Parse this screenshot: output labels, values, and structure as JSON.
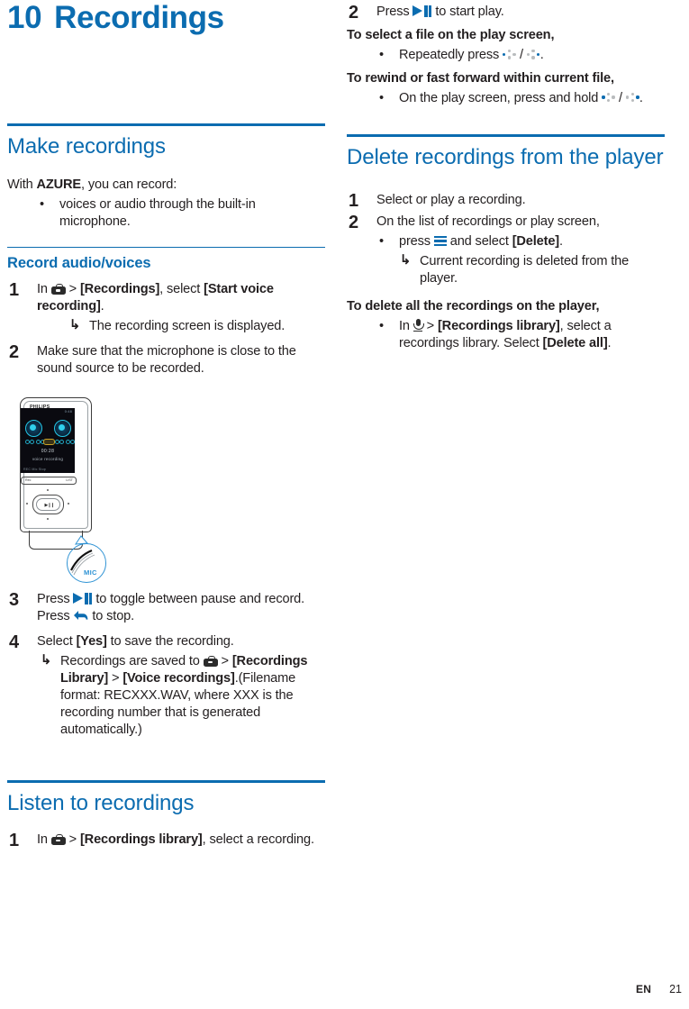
{
  "document": {
    "chapter_number": "10",
    "chapter_title": "Recordings",
    "footer_language": "EN",
    "footer_page": "21",
    "accent_color": "#0b6cb0",
    "text_color": "#231f20"
  },
  "left_column": {
    "section_make_recordings": {
      "heading": "Make recordings",
      "intro_prefix": "With ",
      "intro_brand": "AZURE",
      "intro_suffix": ", you can record:",
      "bullets": [
        "voices or audio through the built-in microphone."
      ]
    },
    "section_record_audio": {
      "heading": "Record audio/voices",
      "steps": [
        {
          "number": "1",
          "text_1": "In ",
          "icon_1": "briefcase-icon",
          "text_2": " > ",
          "bold_1": "[Recordings]",
          "text_3": ", select ",
          "bold_2": "[Start voice recording]",
          "text_4": ".",
          "sub_arrow": "The recording screen is displayed."
        },
        {
          "number": "2",
          "text_1": "Make sure that the microphone is close to the sound source to be recorded."
        },
        {
          "number": "3",
          "text_1": "Press ",
          "icon_1": "play-pause-icon",
          "text_2": " to toggle between pause and record. Press ",
          "icon_2": "back-arrow-icon",
          "text_3": " to stop."
        },
        {
          "number": "4",
          "text_1": "Select ",
          "bold_1": "[Yes]",
          "text_2": " to save the recording.",
          "sub_arrow_1": "Recordings are saved to ",
          "sub_icon": "briefcase-icon",
          "sub_arrow_2": " > ",
          "sub_bold_1": "[Recordings Library]",
          "sub_arrow_3": " > ",
          "sub_bold_2": "[Voice recordings]",
          "sub_arrow_4": ".(Filename format: RECXXX.WAV, where XXX is the recording number that is generated automatically.)"
        }
      ]
    },
    "device_illustration": {
      "brand": "PHILIPS",
      "screen_status": "0:48",
      "screen_time": "00:28",
      "screen_label": "voice  recording",
      "screen_footer": "REC  Mic  Stop",
      "bar_left": "Rec",
      "bar_right": "LIST",
      "play_glyph": "▶❙❙",
      "callout_label": "MIC"
    },
    "section_listen": {
      "heading": "Listen to recordings",
      "steps": [
        {
          "number": "1",
          "text_1": "In ",
          "icon_1": "briefcase-icon",
          "text_2": " > ",
          "bold_1": "[Recordings library]",
          "text_3": ", select a recording."
        }
      ]
    }
  },
  "right_column": {
    "continued_steps": [
      {
        "number": "2",
        "text_1": "Press ",
        "icon_1": "play-pause-icon",
        "text_2": " to start play."
      }
    ],
    "subhead_select_file": "To select a file on the play screen,",
    "bullet_select_file": {
      "text_1": "Repeatedly press ",
      "icon_1": "nav-pad-left-icon",
      "text_2": " / ",
      "icon_2": "nav-pad-right-icon",
      "text_3": "."
    },
    "subhead_rewind": "To rewind or fast forward within current file,",
    "bullet_rewind": {
      "text_1": "On the play screen, press and hold ",
      "icon_1": "nav-pad-left-icon",
      "text_2": " / ",
      "icon_2": "nav-pad-right-icon",
      "text_3": "."
    },
    "section_delete": {
      "heading": "Delete recordings from the player",
      "steps": [
        {
          "number": "1",
          "text_1": "Select or play a recording."
        },
        {
          "number": "2",
          "text_1": "On the list of recordings or play screen,",
          "bullet": {
            "text_1": "press ",
            "icon_1": "hamburger-menu-icon",
            "text_2": " and select ",
            "bold_1": "[Delete]",
            "text_3": "."
          },
          "sub_arrow": "Current recording is deleted from the player."
        }
      ],
      "subhead_delete_all": "To delete all the recordings on the player,",
      "bullet_delete_all": {
        "text_1": "In ",
        "icon_1": "microphone-icon",
        "text_2": " > ",
        "bold_1": "[Recordings library]",
        "text_3": ", select a recordings library. Select ",
        "bold_2": "[Delete all]",
        "text_4": "."
      }
    }
  }
}
